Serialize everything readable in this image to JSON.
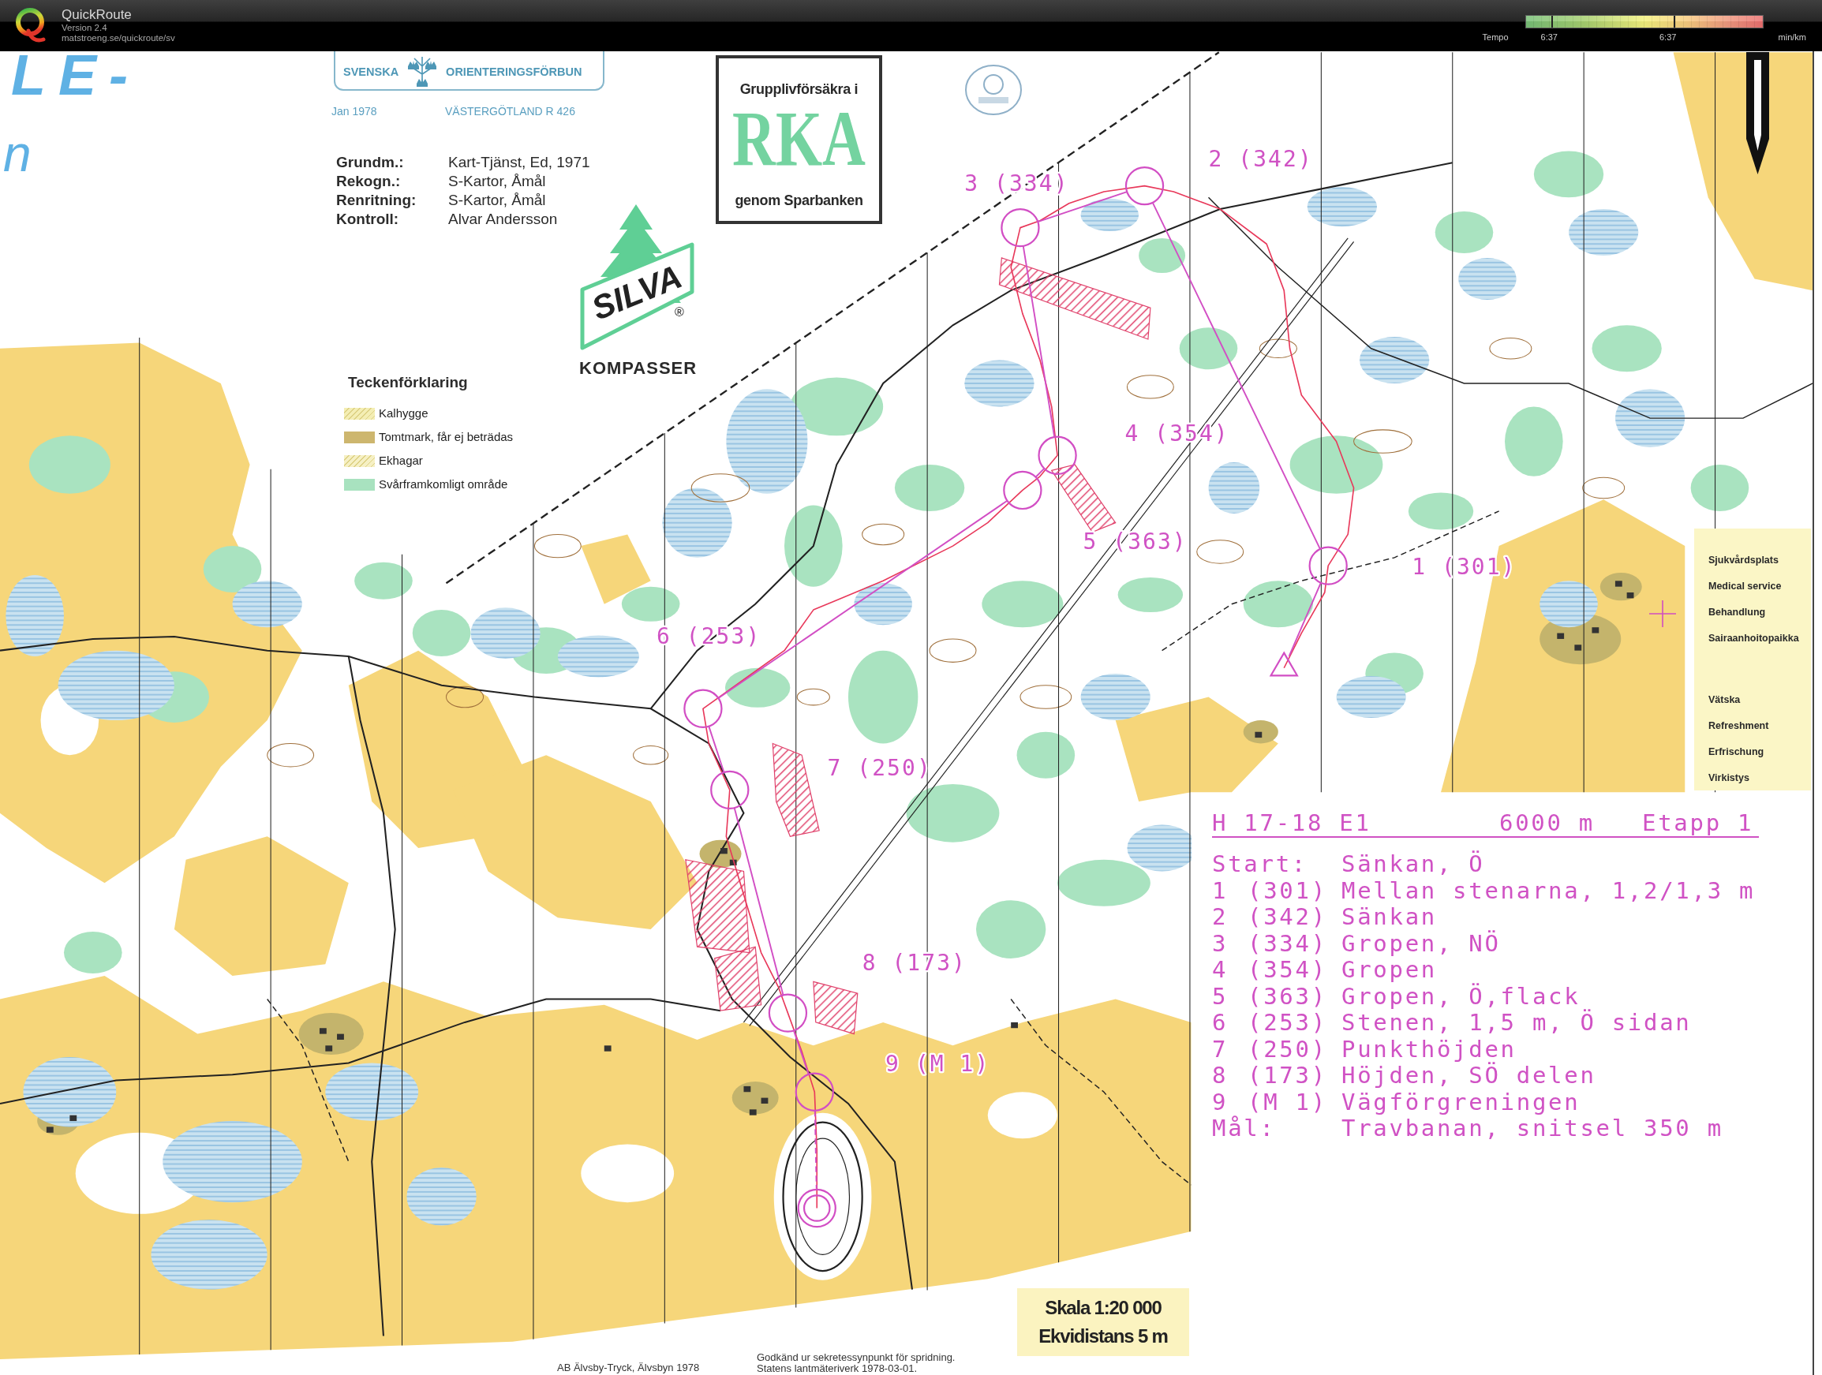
{
  "app": {
    "title": "QuickRoute",
    "version": "Version 2.4",
    "url": "matstroeng.se/quickroute/sv"
  },
  "tempo_scale": {
    "label": "Tempo",
    "tick_labels": [
      "6:37",
      "6:37"
    ],
    "unit": "min/km"
  },
  "map": {
    "title_fragments": [
      "LE-",
      "n"
    ],
    "federation_banner": {
      "left_word": "SVENSKA",
      "right_word": "ORIENTERINGSFÖRBUN",
      "date": "Jan 1978",
      "region": "VÄSTERGÖTLAND R 426"
    },
    "credits": [
      {
        "label": "Grundm.:",
        "value": "Kart-Tjänst, Ed, 1971"
      },
      {
        "label": "Rekogn.:",
        "value": "S-Kartor, Åmål"
      },
      {
        "label": "Renritning:",
        "value": "S-Kartor, Åmål"
      },
      {
        "label": "Kontroll:",
        "value": "Alvar Andersson"
      }
    ],
    "insurance_ad": {
      "line_1": "Grupplivförsäkra i",
      "brand": "RKA",
      "line_2": "genom Sparbanken"
    },
    "compass_ad": {
      "brand": "SILVA",
      "registered_mark": "®",
      "caption": "KOMPASSER"
    },
    "legend": {
      "title": "Teckenförklaring",
      "items": [
        {
          "label": "Kalhygge",
          "kind": "hatched",
          "color": "#f4eeb4"
        },
        {
          "label": "Tomtmark, får ej beträdas",
          "kind": "solid",
          "color": "#cdb66e"
        },
        {
          "label": "Ekhagar",
          "kind": "hatched",
          "color": "#f6f0c4"
        },
        {
          "label": "Svårframkomligt område",
          "kind": "solid",
          "color": "#a8e2bf"
        }
      ]
    },
    "control_labels": [
      "1 (301)",
      "2 (342)",
      "3 (334)",
      "4 (354)",
      "5 (363)",
      "6 (253)",
      "7 (250)",
      "8 (173)",
      "9 (M 1)"
    ],
    "service_legend": {
      "medical": [
        "Sjukvårdsplats",
        "Medical service",
        "Behandlung",
        "Sairaanhoitopaikka"
      ],
      "refreshment": [
        "Vätska",
        "Refreshment",
        "Erfrischung",
        "Virkistys"
      ]
    },
    "course_card": {
      "category": "H 17-18 E1",
      "length": "6000 m",
      "stage": "Etapp 1",
      "rows": [
        {
          "label": "Start:",
          "description": "Sänkan, Ö"
        },
        {
          "label": "1",
          "code": "(301)",
          "description": "Mellan stenarna, 1,2/1,3 m"
        },
        {
          "label": "2",
          "code": "(342)",
          "description": "Sänkan"
        },
        {
          "label": "3",
          "code": "(334)",
          "description": "Gropen, NÖ"
        },
        {
          "label": "4",
          "code": "(354)",
          "description": "Gropen"
        },
        {
          "label": "5",
          "code": "(363)",
          "description": "Gropen, Ö,flack"
        },
        {
          "label": "6",
          "code": "(253)",
          "description": "Stenen, 1,5 m, Ö sidan"
        },
        {
          "label": "7",
          "code": "(250)",
          "description": "Punkthöjden"
        },
        {
          "label": "8",
          "code": "(173)",
          "description": "Höjden, SÖ delen"
        },
        {
          "label": "9",
          "code": "(M 1)",
          "description": "Vägförgreningen"
        },
        {
          "label": "Mål:",
          "description": "Travbanan, snitsel 350 m"
        }
      ]
    },
    "scale_panel": {
      "scale": "Skala 1:20 000",
      "contour_interval": "Ekvidistans 5 m"
    },
    "printer_note": "AB Älvsby-Tryck, Älvsbyn 1978",
    "approval_note": [
      "Godkänd ur sekretessynpunkt för spridning.",
      "Statens lantmäteriverk 1978-03-01."
    ]
  }
}
